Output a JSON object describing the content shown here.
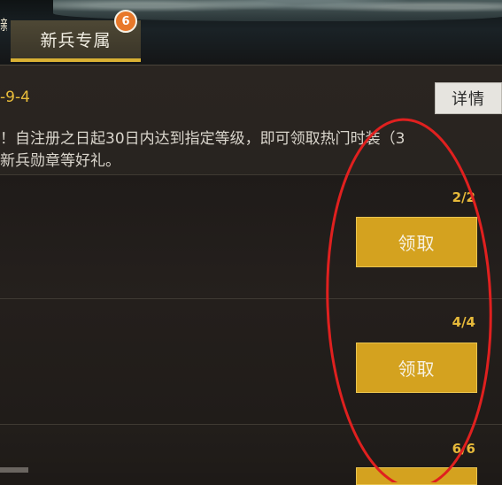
{
  "header": {
    "left_fragment": "新",
    "tab": {
      "label": "新兵专属",
      "badge_count": "6",
      "accent": "#d8b034"
    }
  },
  "event": {
    "date_fragment": "-9-4",
    "detail_label": "详情",
    "description_line1": "！自注册之日起30日内达到指定等级，即可领取热门时装（3",
    "description_line2": "新兵勋章等好礼。"
  },
  "rewards": [
    {
      "progress": "2/2",
      "claim_label": "领取"
    },
    {
      "progress": "4/4",
      "claim_label": "领取"
    },
    {
      "progress": "6/6",
      "claim_label": ""
    }
  ],
  "colors": {
    "gold": "#d4a21f",
    "badge": "#e8782a",
    "annotation_circle": "#e0201f"
  }
}
